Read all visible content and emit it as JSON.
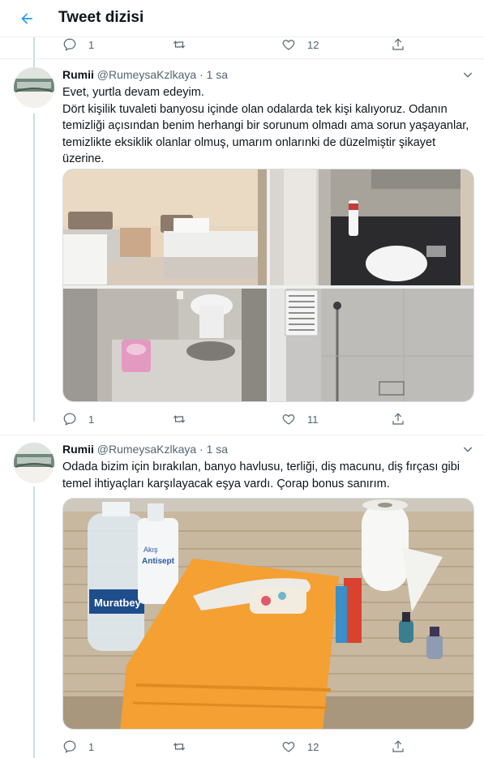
{
  "header": {
    "title": "Tweet dizisi",
    "back_icon": "arrow-left-icon",
    "accent": "#1d9bf0"
  },
  "top_actions": {
    "reply_count": "1",
    "retweet_count": "",
    "like_count": "12"
  },
  "tweets": [
    {
      "name": "Rumii",
      "handle": "@RumeysaKzlkaya",
      "dot": "·",
      "time": "1 sa",
      "text": [
        "Evet, yurtla devam edeyim.",
        "Dört kişilik tuvaleti banyosu içinde olan odalarda tek kişi kalıyoruz. Odanın temizliği açısından benim herhangi bir sorunum olmadı ama sorun yaşayanlar, temizlikte eksiklik olanlar olmuş, umarım onlarınki de düzelmiştir şikayet üzerine."
      ],
      "media": [
        "dorm-bedroom-photo",
        "bathroom-sink-photo",
        "toilet-photo",
        "shower-photo"
      ],
      "actions": {
        "reply_count": "1",
        "retweet_count": "",
        "like_count": "11"
      }
    },
    {
      "name": "Rumii",
      "handle": "@RumeysaKzlkaya",
      "dot": "·",
      "time": "1 sa",
      "text": [
        "Odada bizim için bırakılan, banyo havlusu, terliği, diş macunu, diş fırçası gibi temel ihtiyaçları karşılayacak eşya vardı. Çorap bonus sanırım."
      ],
      "media_labels": {
        "water_bottle": "Muratbey",
        "disinfectant_brand": "Akış",
        "disinfectant_name": "Antisept"
      },
      "actions": {
        "reply_count": "1",
        "retweet_count": "",
        "like_count": "12"
      }
    }
  ]
}
